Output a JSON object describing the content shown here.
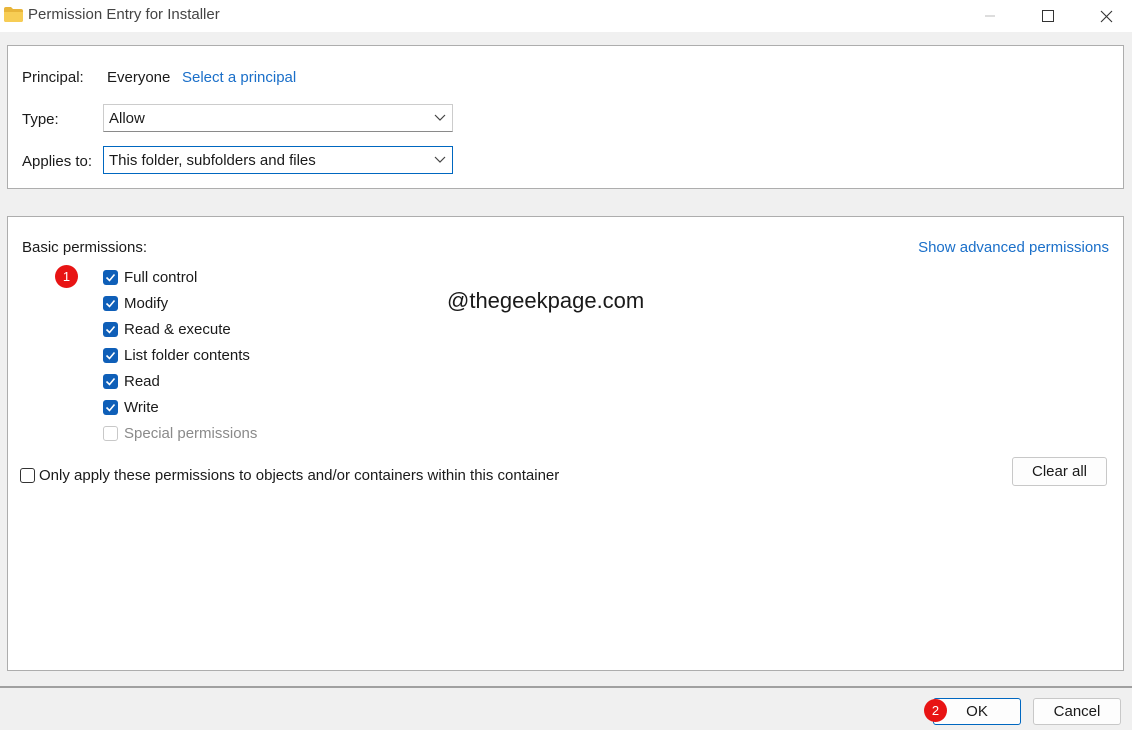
{
  "window": {
    "title": "Permission Entry for Installer"
  },
  "principal": {
    "label": "Principal:",
    "value": "Everyone",
    "select_link": "Select a principal"
  },
  "type": {
    "label": "Type:",
    "value": "Allow"
  },
  "applies_to": {
    "label": "Applies to:",
    "value": "This folder, subfolders and files"
  },
  "basic_permissions": {
    "heading": "Basic permissions:",
    "advanced_link": "Show advanced permissions",
    "items": [
      {
        "label": "Full control",
        "checked": true,
        "enabled": true
      },
      {
        "label": "Modify",
        "checked": true,
        "enabled": true
      },
      {
        "label": "Read & execute",
        "checked": true,
        "enabled": true
      },
      {
        "label": "List folder contents",
        "checked": true,
        "enabled": true
      },
      {
        "label": "Read",
        "checked": true,
        "enabled": true
      },
      {
        "label": "Write",
        "checked": true,
        "enabled": true
      },
      {
        "label": "Special permissions",
        "checked": false,
        "enabled": false
      }
    ],
    "only_apply_label": "Only apply these permissions to objects and/or containers within this container",
    "only_apply_checked": false,
    "clear_all_label": "Clear all"
  },
  "watermark": "@thegeekpage.com",
  "badges": {
    "step1": "1",
    "step2": "2"
  },
  "buttons": {
    "ok": "OK",
    "cancel": "Cancel"
  },
  "colors": {
    "accent": "#0067c0",
    "checkbox": "#0f5fb8",
    "link": "#1a6fc9",
    "badge": "#e81414"
  }
}
